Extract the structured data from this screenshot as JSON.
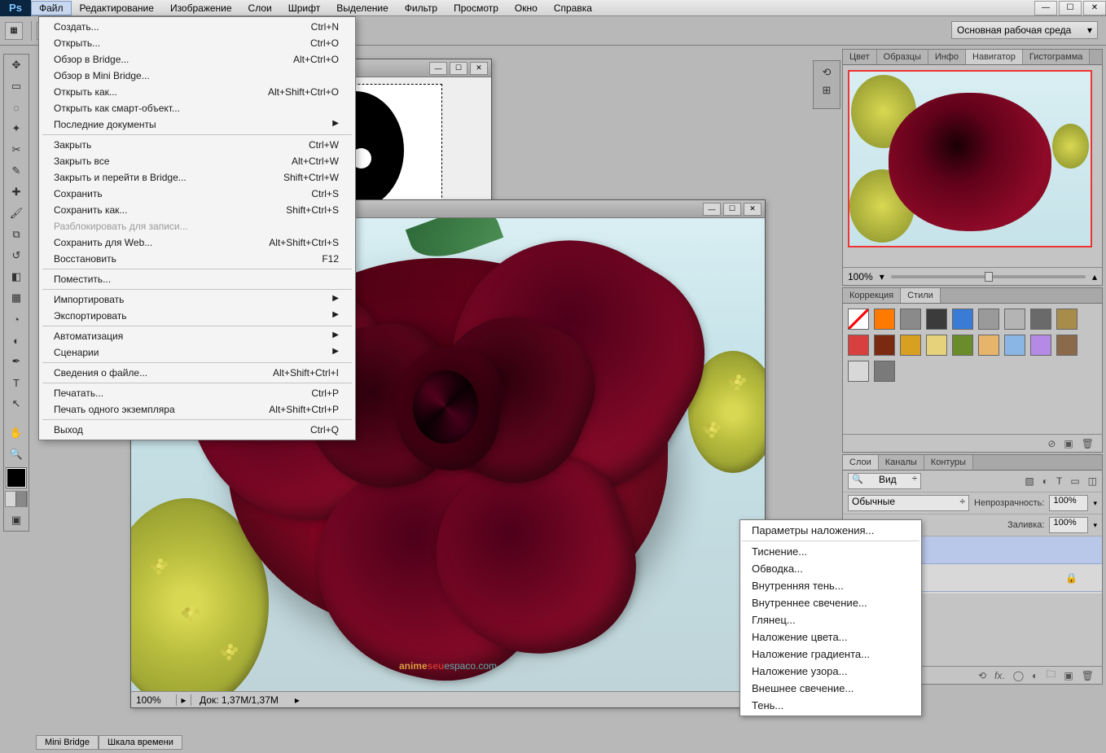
{
  "menubar": {
    "items": [
      "Файл",
      "Редактирование",
      "Изображение",
      "Слои",
      "Шрифт",
      "Выделение",
      "Фильтр",
      "Просмотр",
      "Окно",
      "Справка"
    ]
  },
  "workspace_label": "Основная рабочая среда",
  "file_menu": [
    {
      "label": "Создать...",
      "shortcut": "Ctrl+N"
    },
    {
      "label": "Открыть...",
      "shortcut": "Ctrl+O"
    },
    {
      "label": "Обзор в Bridge...",
      "shortcut": "Alt+Ctrl+O"
    },
    {
      "label": "Обзор в Mini Bridge...",
      "shortcut": ""
    },
    {
      "label": "Открыть как...",
      "shortcut": "Alt+Shift+Ctrl+O"
    },
    {
      "label": "Открыть как смарт-объект...",
      "shortcut": ""
    },
    {
      "label": "Последние документы",
      "shortcut": "",
      "sub": true
    },
    {
      "sep": true
    },
    {
      "label": "Закрыть",
      "shortcut": "Ctrl+W"
    },
    {
      "label": "Закрыть все",
      "shortcut": "Alt+Ctrl+W"
    },
    {
      "label": "Закрыть и перейти в Bridge...",
      "shortcut": "Shift+Ctrl+W"
    },
    {
      "label": "Сохранить",
      "shortcut": "Ctrl+S"
    },
    {
      "label": "Сохранить как...",
      "shortcut": "Shift+Ctrl+S"
    },
    {
      "label": "Разблокировать для записи...",
      "shortcut": "",
      "disabled": true
    },
    {
      "label": "Сохранить для Web...",
      "shortcut": "Alt+Shift+Ctrl+S"
    },
    {
      "label": "Восстановить",
      "shortcut": "F12"
    },
    {
      "sep": true
    },
    {
      "label": "Поместить...",
      "shortcut": ""
    },
    {
      "sep": true
    },
    {
      "label": "Импортировать",
      "shortcut": "",
      "sub": true
    },
    {
      "label": "Экспортировать",
      "shortcut": "",
      "sub": true
    },
    {
      "sep": true
    },
    {
      "label": "Автоматизация",
      "shortcut": "",
      "sub": true
    },
    {
      "label": "Сценарии",
      "shortcut": "",
      "sub": true
    },
    {
      "sep": true
    },
    {
      "label": "Сведения о файле...",
      "shortcut": "Alt+Shift+Ctrl+I"
    },
    {
      "sep": true
    },
    {
      "label": "Печатать...",
      "shortcut": "Ctrl+P"
    },
    {
      "label": "Печать одного экземпляра",
      "shortcut": "Alt+Shift+Ctrl+P"
    },
    {
      "sep": true
    },
    {
      "label": "Выход",
      "shortcut": "Ctrl+Q"
    }
  ],
  "context_menu": [
    {
      "label": "Параметры наложения..."
    },
    {
      "sep": true
    },
    {
      "label": "Тиснение..."
    },
    {
      "label": "Обводка..."
    },
    {
      "label": "Внутренняя тень..."
    },
    {
      "label": "Внутреннее свечение..."
    },
    {
      "label": "Глянец..."
    },
    {
      "label": "Наложение цвета..."
    },
    {
      "label": "Наложение градиента..."
    },
    {
      "label": "Наложение узора..."
    },
    {
      "label": "Внешнее свечение..."
    },
    {
      "label": "Тень..."
    }
  ],
  "navigator": {
    "tabs": [
      "Цвет",
      "Образцы",
      "Инфо",
      "Навигатор",
      "Гистограмма"
    ],
    "active": 3,
    "zoom": "100%"
  },
  "styles": {
    "tabs": [
      "Коррекция",
      "Стили"
    ],
    "active": 1,
    "swatches": [
      "#fff",
      "#ff7a00",
      "#8a8a8a",
      "#3b3b3b",
      "#3a7bd5",
      "#9a9a9a",
      "#b4b4b4",
      "#6a6a6a",
      "#a88c4a",
      "#d84040",
      "#7a2a10",
      "#d8a020",
      "#e6d27a",
      "#6a8c2a",
      "#e6b46a",
      "#8ab6e6",
      "#b48ae6",
      "#8a6a4a",
      "#d8d8d8",
      "#7a7a7a"
    ]
  },
  "layers": {
    "tabs": [
      "Слои",
      "Каналы",
      "Контуры"
    ],
    "active": 0,
    "filter_label": "Вид",
    "mode_label": "Обычные",
    "opacity_label": "Непрозрачность:",
    "opacity_value": "100%",
    "fill_label": "Заливка:",
    "fill_value": "100%"
  },
  "doc2": {
    "zoom": "100%",
    "docinfo": "Док: 1,37M/1,37M"
  },
  "watermark": {
    "w1": "anime",
    "w2": "seu",
    "w3": "espaco.com"
  },
  "bottom_tabs": [
    "Mini Bridge",
    "Шкала времени"
  ]
}
